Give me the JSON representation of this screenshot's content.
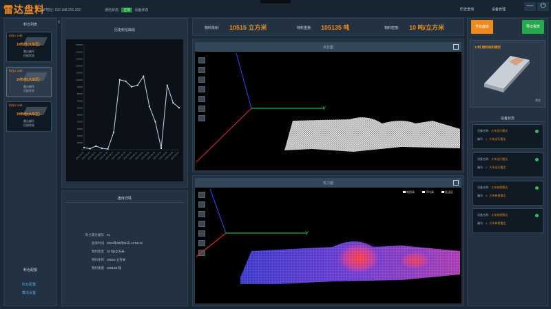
{
  "app": {
    "title": "雷达盘料"
  },
  "header": {
    "ip_label": "IP地址:",
    "ip_value": "192.168.201.202",
    "conn_label": "通信状态:",
    "conn_value": "正常",
    "conn_suffix": "设备状态",
    "menu": [
      "历史查询",
      "设备管理"
    ],
    "minimize": "—",
    "power": "⏻"
  },
  "left": {
    "title": "料仓列表",
    "devices": [
      {
        "name": "料仓1  1#料",
        "big": "1#料仓(大车区)",
        "lines": [
          "雷达编号",
          "扫描状态"
        ]
      },
      {
        "name": "料仓2  2#料",
        "big": "2#料仓(大车区)",
        "lines": [
          "雷达编号",
          "扫描状态"
        ]
      },
      {
        "name": "料仓3  3#料",
        "big": "3#料仓(大车区)",
        "lines": [
          "雷达编号",
          "扫描状态"
        ]
      }
    ],
    "footer_title": "料仓配置",
    "links": [
      "料仓配置",
      "算法设置"
    ]
  },
  "history": {
    "title": "历史料位曲线"
  },
  "detail": {
    "title": "盘库详情",
    "rows": [
      {
        "label": "料仓雷达编号",
        "value": "01"
      },
      {
        "label": "盘库时间",
        "value": "2024年09月01日 14:56:41"
      },
      {
        "label": "物料密度",
        "value": "10 吨/立方米"
      },
      {
        "label": "物料体积",
        "value": "10515 立方米"
      },
      {
        "label": "物料重量",
        "value": "105135 吨"
      }
    ]
  },
  "stats": [
    {
      "label": "物料体积:",
      "value": "10515 立方米"
    },
    {
      "label": "物料重量:",
      "value": "105135 吨"
    },
    {
      "label": "物料密度:",
      "value": "10 吨/立方米"
    }
  ],
  "views": {
    "top_title": "点云图",
    "bottom_title": "热力图",
    "legend": [
      "堆积高",
      "平均高",
      "低洼区"
    ],
    "axis_y": "Y"
  },
  "right": {
    "btn_start": "开始盘库",
    "btn_export": "导出报表",
    "preview_title": "1#料 物料堆积模型",
    "preview_foot": "预览",
    "status_title": "设备状态",
    "cards": [
      {
        "l1": "设备名称:",
        "v1": "大车运行雷达",
        "l2": "编号:",
        "v2": "1",
        "l3": "大车运行雷达"
      },
      {
        "l1": "设备名称:",
        "v1": "大车运行雷达",
        "l2": "编号:",
        "v2": "2",
        "l3": "大车运行雷达"
      },
      {
        "l1": "设备名称:",
        "v1": "大车俯视雷达",
        "l2": "编号:",
        "v2": "3",
        "l3": "大车俯视雷达"
      },
      {
        "l1": "设备名称:",
        "v1": "大车俯视雷达",
        "l2": "编号:",
        "v2": "4",
        "l3": "大车俯视雷达"
      }
    ]
  },
  "chart_data": {
    "type": "line",
    "title": "",
    "x": [
      "2024-08-22",
      "2024-08-23",
      "2024-08-24",
      "2024-08-25",
      "2024-08-26",
      "2024-08-27",
      "2024-08-28",
      "2024-08-29",
      "2024-08-30",
      "2024-08-31",
      "2024-09-01",
      "2024-09-02",
      "2024-09-03",
      "2024-09-04",
      "2024-09-05",
      "2024-09-06",
      "2024-09-07"
    ],
    "values": [
      3000,
      1500,
      5000,
      2000,
      1000,
      25000,
      100000,
      98000,
      90000,
      92000,
      105000,
      62000,
      40000,
      2000,
      92000,
      67000,
      60000
    ],
    "yticks": [
      0,
      10000,
      20000,
      30000,
      40000,
      50000,
      60000,
      70000,
      80000,
      90000,
      100000,
      110000,
      120000,
      130000,
      140000,
      150000
    ],
    "ylim": [
      0,
      150000
    ],
    "color": "#b8c8e0"
  }
}
